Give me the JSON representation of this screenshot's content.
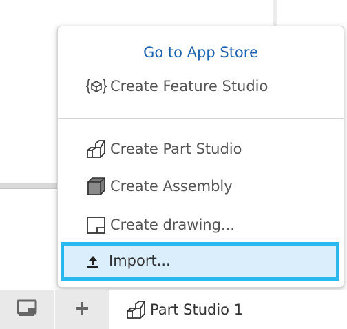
{
  "menu": {
    "app_store_label": "Go to App Store",
    "items": [
      {
        "label": "Create Feature Studio",
        "icon": "feature-studio-icon"
      },
      {
        "label": "Create Part Studio",
        "icon": "part-studio-icon"
      },
      {
        "label": "Create Assembly",
        "icon": "assembly-icon"
      },
      {
        "label": "Create drawing...",
        "icon": "drawing-icon"
      },
      {
        "label": "Import...",
        "icon": "upload-icon",
        "highlighted": true
      }
    ]
  },
  "tabbar": {
    "buttons": [
      {
        "icon": "panel-toggle-icon"
      },
      {
        "icon": "plus-icon"
      }
    ],
    "tabs": [
      {
        "label": "Part Studio 1",
        "icon": "part-studio-icon"
      }
    ]
  },
  "colors": {
    "link": "#1d63b0",
    "highlight_fill": "#dbeefb",
    "highlight_border": "#2bb8ef",
    "menu_text": "#555555"
  }
}
